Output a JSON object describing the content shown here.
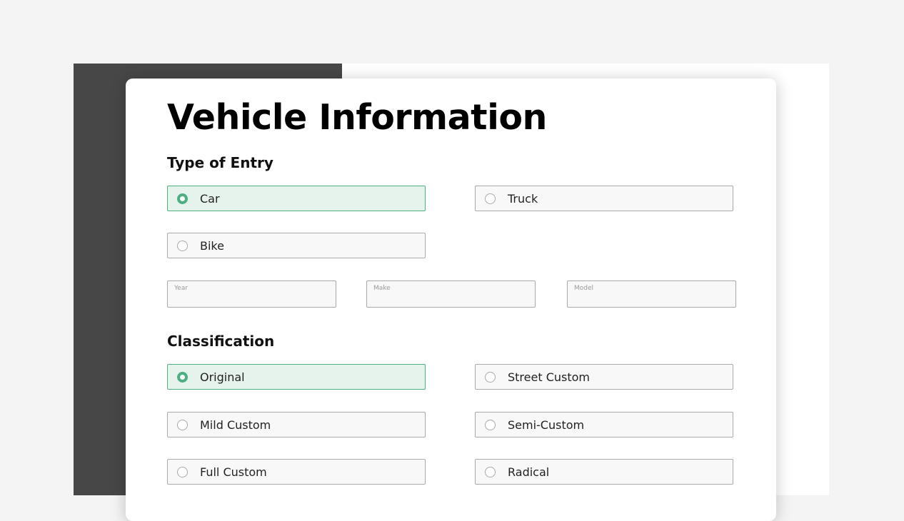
{
  "page_title": "Vehicle Information",
  "type_of_entry": {
    "heading": "Type of Entry",
    "options": [
      {
        "label": "Car",
        "selected": true
      },
      {
        "label": "Truck",
        "selected": false
      },
      {
        "label": "Bike",
        "selected": false
      }
    ]
  },
  "vehicle_fields": {
    "year": {
      "label": "Year",
      "value": ""
    },
    "make": {
      "label": "Make",
      "value": ""
    },
    "model": {
      "label": "Model",
      "value": ""
    }
  },
  "classification": {
    "heading": "Classification",
    "options": [
      {
        "label": "Original",
        "selected": true
      },
      {
        "label": "Street Custom",
        "selected": false
      },
      {
        "label": "Mild Custom",
        "selected": false
      },
      {
        "label": "Semi-Custom",
        "selected": false
      },
      {
        "label": "Full Custom",
        "selected": false
      },
      {
        "label": "Radical",
        "selected": false
      }
    ]
  },
  "colors": {
    "accent": "#4caf80",
    "selected_background": "#e5f3ec",
    "dark_panel": "#474747",
    "page_background": "#f4f4f4"
  }
}
